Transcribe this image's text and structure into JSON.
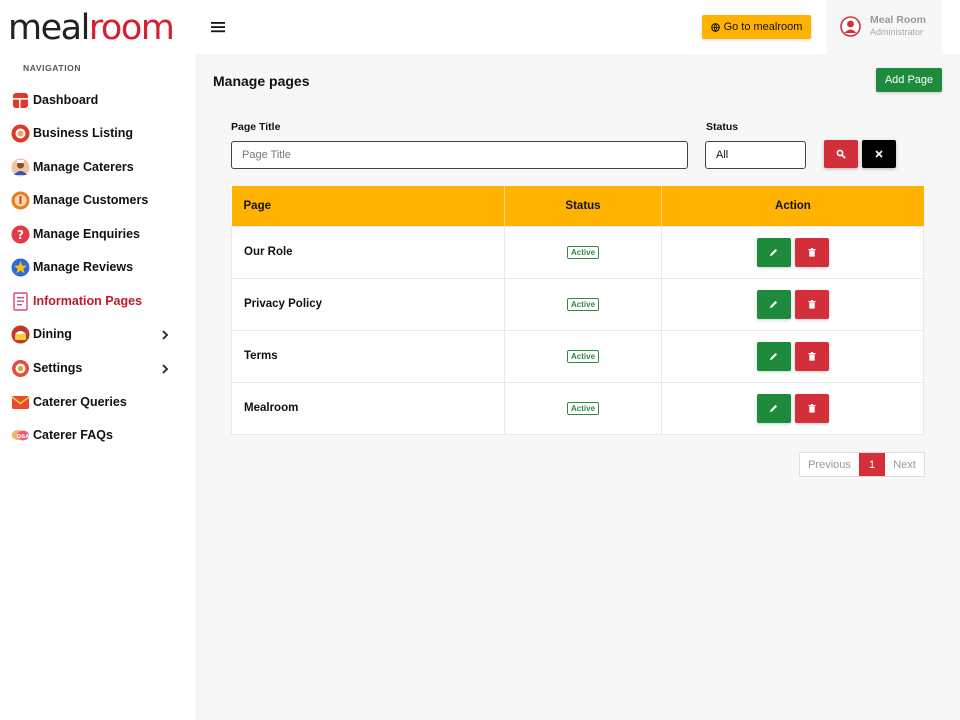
{
  "logo": {
    "part1": "meal",
    "part2": "room"
  },
  "nav": {
    "heading": "NAVIGATION",
    "items": [
      {
        "label": "Dashboard",
        "icon": "dashboard-icon",
        "color": "#e8352c"
      },
      {
        "label": "Business Listing",
        "icon": "business-listing-icon",
        "color": "#d83b2c"
      },
      {
        "label": "Manage Caterers",
        "icon": "caterer-icon",
        "color": "#c0392b"
      },
      {
        "label": "Manage Customers",
        "icon": "customer-icon",
        "color": "#e67e22"
      },
      {
        "label": "Manage Enquiries",
        "icon": "question-icon",
        "color": "#e63946"
      },
      {
        "label": "Manage Reviews",
        "icon": "star-icon",
        "color": "#2e6bd6"
      },
      {
        "label": "Information Pages",
        "icon": "document-icon",
        "color": "#e0457b"
      },
      {
        "label": "Dining",
        "icon": "dining-icon",
        "color": "#c0392b"
      },
      {
        "label": "Settings",
        "icon": "settings-icon",
        "color": "#e74c3c"
      },
      {
        "label": "Caterer Queries",
        "icon": "mail-icon",
        "color": "#e84c2c"
      },
      {
        "label": "Caterer FAQs",
        "icon": "faq-icon",
        "color": "#f39c3c"
      }
    ],
    "active_index": 6
  },
  "header": {
    "go_button": "Go to mealroom",
    "user_name": "Meal Room",
    "user_role": "Administrator"
  },
  "main": {
    "title": "Manage pages",
    "add_button": "Add Page",
    "filters": {
      "page_title_label": "Page Title",
      "page_title_placeholder": "Page Title",
      "page_title_value": "",
      "status_label": "Status",
      "status_value": "All"
    },
    "table": {
      "columns": [
        "Page",
        "Status",
        "Action"
      ],
      "rows": [
        {
          "page": "Our Role",
          "status": "Active"
        },
        {
          "page": "Privacy Policy",
          "status": "Active"
        },
        {
          "page": "Terms",
          "status": "Active"
        },
        {
          "page": "Mealroom",
          "status": "Active"
        }
      ]
    },
    "pagination": {
      "previous": "Previous",
      "current": "1",
      "next": "Next"
    }
  },
  "colors": {
    "brand_red": "#d51f2f",
    "accent_yellow": "#ffb300",
    "success_green": "#1e8a3b",
    "danger_red": "#d32f3a"
  }
}
